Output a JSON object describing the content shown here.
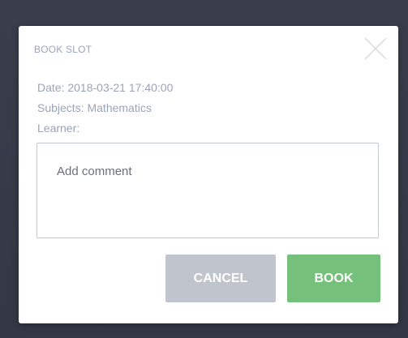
{
  "modal": {
    "title": "BOOK SLOT",
    "date_line": "Date: 2018-03-21 17:40:00",
    "subjects_line": "Subjects: Mathematics",
    "learner_line": "Learner:",
    "comment_placeholder": "Add comment",
    "comment_value": "",
    "close_icon": "close-icon",
    "buttons": {
      "cancel_label": "CANCEL",
      "book_label": "BOOK"
    }
  },
  "colors": {
    "backdrop": "#373b49",
    "muted_text": "#9aa3b8",
    "cancel_button": "#bfc4cd",
    "book_button": "#75c17b"
  }
}
